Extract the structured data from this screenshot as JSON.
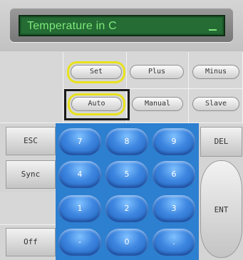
{
  "display": {
    "text": "Temperature in C",
    "cursor": "_"
  },
  "modes": {
    "row1": [
      "Set",
      "Plus",
      "Minus"
    ],
    "row2": [
      "Auto",
      "Manual",
      "Slave"
    ]
  },
  "left_keys": {
    "esc": "ESC",
    "sync": "Sync",
    "off": "Off"
  },
  "right_keys": {
    "del": "DEL",
    "ent": "ENT"
  },
  "keypad": {
    "row1": [
      "7",
      "8",
      "9"
    ],
    "row2": [
      "4",
      "5",
      "6"
    ],
    "row3": [
      "1",
      "2",
      "3"
    ],
    "row4": [
      "-",
      "0",
      "."
    ]
  },
  "colors": {
    "lcd_bg": "#246b34",
    "lcd_text": "#7ee87a",
    "keypad_blue": "#2d7fd0",
    "highlight": "#e8e21c"
  }
}
